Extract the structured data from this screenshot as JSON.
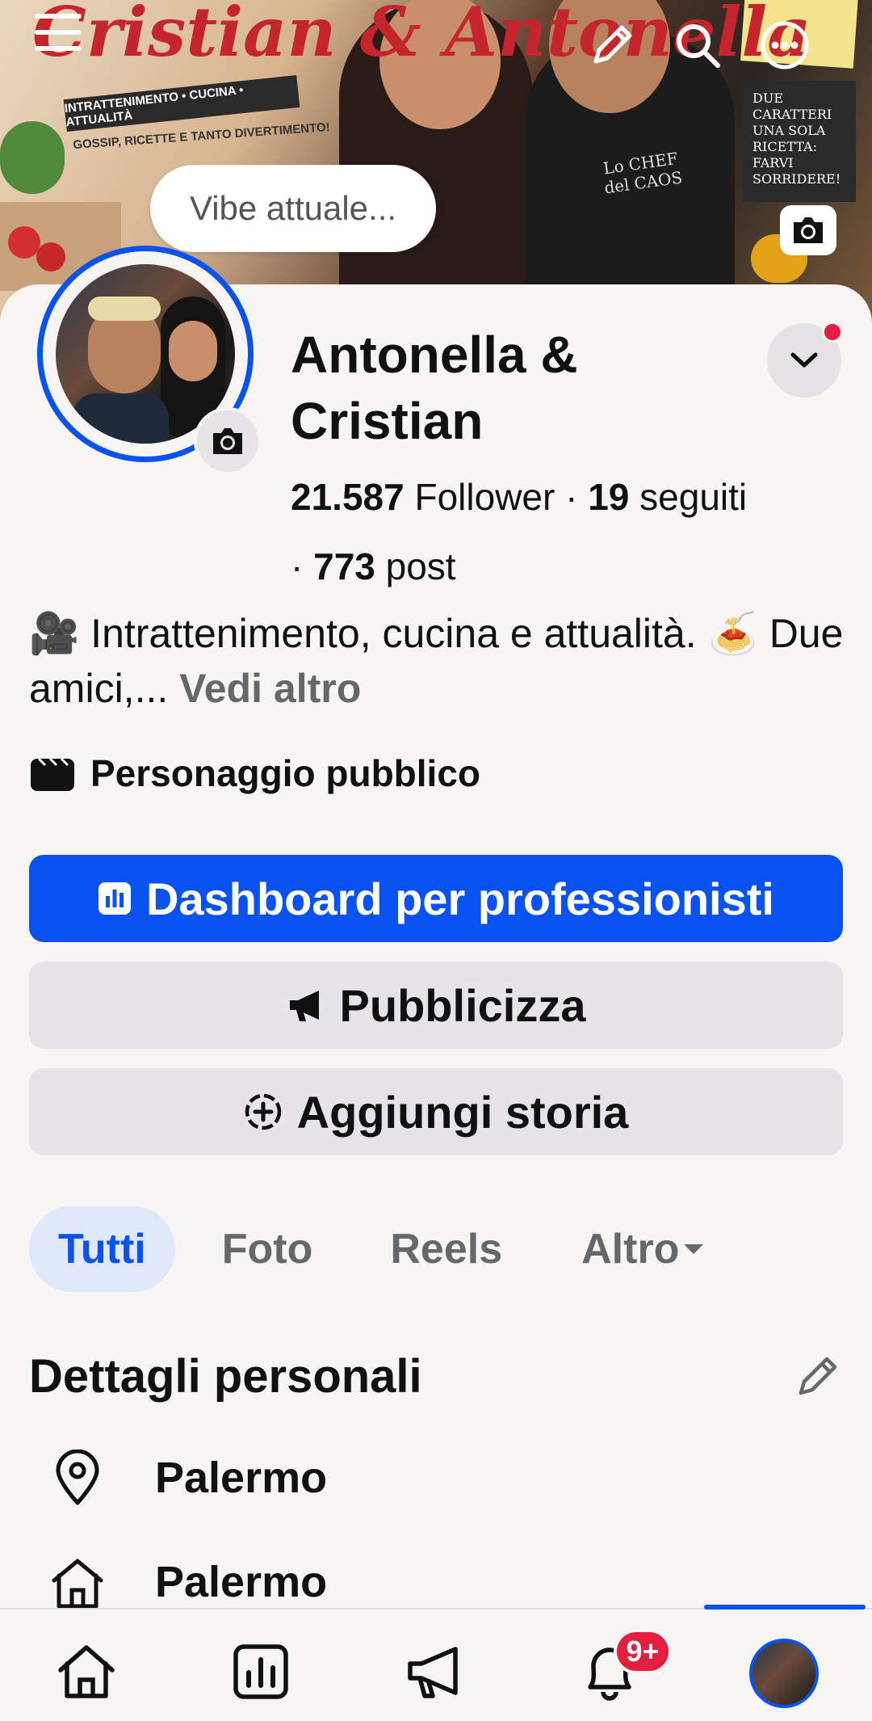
{
  "cover": {
    "title": "Cristian & Antonella",
    "banner": "INTRATTENIMENTO • CUCINA • ATTUALITÀ",
    "subtitle": "GOSSIP, RICETTE E TANTO DIVERTIMENTO!",
    "chalkboard": "DUE CARATTERI UNA SOLA RICETTA: FARVI SORRIDERE!",
    "apron": "Lo CHEF del CAOS"
  },
  "vibe": {
    "placeholder": "Vibe attuale..."
  },
  "profile": {
    "name": "Antonella & Cristian",
    "followers_count": "21.587",
    "followers_label": "Follower",
    "following_count": "19",
    "following_label": "seguiti",
    "posts_count": "773",
    "posts_label": "post",
    "bio_emoji1": "🎥",
    "bio_text": "Intrattenimento, cucina e attualità.",
    "bio_emoji2": "🍝",
    "bio_text2": "Due amici,...",
    "bio_more": "Vedi altro",
    "category": "Personaggio pubblico"
  },
  "buttons": {
    "dashboard": "Dashboard per professionisti",
    "promote": "Pubblicizza",
    "add_story": "Aggiungi storia"
  },
  "tabs": [
    {
      "label": "Tutti",
      "active": true
    },
    {
      "label": "Foto"
    },
    {
      "label": "Reels"
    },
    {
      "label": "Altro"
    }
  ],
  "details": {
    "title": "Dettagli personali",
    "rows": [
      {
        "icon": "location-pin-icon",
        "text": "Palermo"
      },
      {
        "icon": "home-icon",
        "text": "Palermo"
      }
    ]
  },
  "bottom_nav": {
    "notifications_badge": "9+"
  },
  "colors": {
    "accent": "#0a52f0",
    "badge": "#e41e3f",
    "background": "#f6f5f3",
    "grey_button": "#e6e4e8"
  }
}
